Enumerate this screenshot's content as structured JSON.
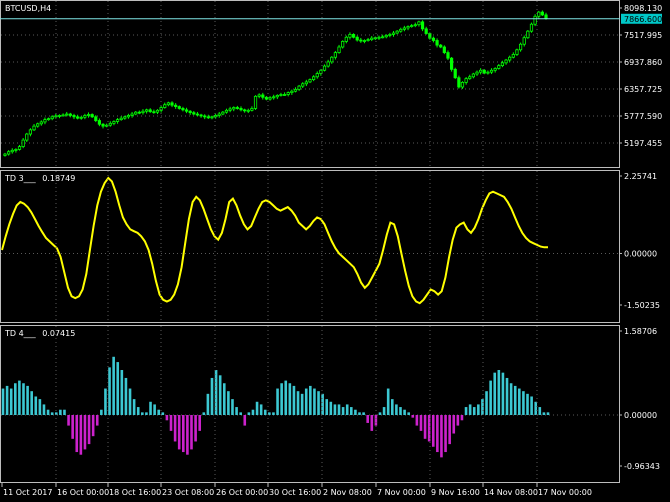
{
  "symbol_title": "BTCUSD,H4",
  "colors": {
    "background": "#000000",
    "bull_candle": "#00ff00",
    "bid_line": "#7fe6e6",
    "bid_box": "#00c8c8",
    "td3_line": "#ffff00",
    "hist_pos": "#3cc8d2",
    "hist_neg": "#cc22cc",
    "grid": "#5a5a5a",
    "separator": "#bdbdbd"
  },
  "price_panel": {
    "ticks": [
      "8098.130",
      "7517.995",
      "6937.860",
      "6357.725",
      "5777.590",
      "5197.455"
    ],
    "tick_values": [
      8098.13,
      7517.995,
      6937.86,
      6357.725,
      5777.59,
      5197.455
    ],
    "bid_label": "7866.600",
    "bid_value": 7866.6
  },
  "td3_panel": {
    "label": "TD 3___",
    "value": "0.18749",
    "ticks": [
      "2.25741",
      "0.00000",
      "-1.50235"
    ],
    "tick_values": [
      2.25741,
      0.0,
      -1.50235
    ]
  },
  "td4_panel": {
    "label": "TD 4___",
    "value": "0.07415",
    "ticks": [
      "1.58706",
      "0.00000",
      "-0.96343"
    ],
    "tick_values": [
      1.58706,
      0.0,
      -0.96343
    ]
  },
  "time_axis": [
    "11 Oct 2017",
    "16 Oct 00:00",
    "18 Oct 16:00",
    "23 Oct 08:00",
    "26 Oct 00:00",
    "30 Oct 16:00",
    "2 Nov 08:00",
    "7 Nov 00:00",
    "9 Nov 16:00",
    "14 Nov 08:00",
    "17 Nov 00:00"
  ],
  "chart_data": [
    {
      "type": "candlestick",
      "title": "BTCUSD,H4",
      "ylim": [
        5050,
        8160
      ],
      "close": [
        4960,
        5010,
        5040,
        5060,
        5120,
        5260,
        5390,
        5480,
        5560,
        5610,
        5650,
        5700,
        5720,
        5760,
        5780,
        5790,
        5800,
        5820,
        5790,
        5760,
        5730,
        5750,
        5790,
        5810,
        5760,
        5680,
        5600,
        5560,
        5580,
        5620,
        5660,
        5700,
        5730,
        5760,
        5790,
        5820,
        5860,
        5850,
        5880,
        5910,
        5870,
        5860,
        5900,
        5960,
        6020,
        6060,
        6010,
        5980,
        5940,
        5910,
        5880,
        5850,
        5820,
        5800,
        5780,
        5760,
        5740,
        5760,
        5790,
        5820,
        5860,
        5900,
        5930,
        5960,
        5940,
        5910,
        5890,
        5900,
        5940,
        6200,
        6230,
        6180,
        6140,
        6170,
        6190,
        6220,
        6240,
        6240,
        6280,
        6310,
        6350,
        6420,
        6470,
        6510,
        6560,
        6620,
        6690,
        6760,
        6850,
        6940,
        7040,
        7140,
        7260,
        7380,
        7470,
        7530,
        7470,
        7410,
        7390,
        7400,
        7420,
        7450,
        7460,
        7470,
        7480,
        7510,
        7530,
        7560,
        7600,
        7640,
        7670,
        7700,
        7720,
        7740,
        7800,
        7650,
        7550,
        7450,
        7400,
        7300,
        7260,
        7140,
        7020,
        6780,
        6600,
        6400,
        6500,
        6580,
        6620,
        6680,
        6720,
        6760,
        6700,
        6720,
        6760,
        6800,
        6860,
        6920,
        6980,
        7040,
        7100,
        7200,
        7320,
        7460,
        7600,
        7750,
        7920,
        8010,
        7950,
        7880
      ],
      "series_note": ""
    },
    {
      "type": "line",
      "title": "TD 3___",
      "y": [
        0.1,
        0.5,
        0.85,
        1.15,
        1.4,
        1.5,
        1.45,
        1.35,
        1.2,
        1.0,
        0.8,
        0.62,
        0.45,
        0.35,
        0.25,
        0.15,
        -0.1,
        -0.55,
        -1.0,
        -1.25,
        -1.3,
        -1.25,
        -1.05,
        -0.6,
        0.1,
        0.8,
        1.4,
        1.8,
        2.05,
        2.2,
        2.1,
        1.8,
        1.4,
        1.05,
        0.85,
        0.7,
        0.65,
        0.6,
        0.5,
        0.35,
        0.1,
        -0.3,
        -0.8,
        -1.2,
        -1.35,
        -1.4,
        -1.35,
        -1.2,
        -0.9,
        -0.4,
        0.3,
        1.0,
        1.5,
        1.65,
        1.55,
        1.3,
        1.0,
        0.7,
        0.5,
        0.4,
        0.6,
        1.0,
        1.5,
        1.6,
        1.4,
        1.1,
        0.85,
        0.7,
        0.8,
        1.05,
        1.3,
        1.5,
        1.55,
        1.5,
        1.4,
        1.3,
        1.25,
        1.3,
        1.35,
        1.25,
        1.1,
        0.9,
        0.8,
        0.7,
        0.8,
        0.95,
        1.05,
        1.0,
        0.85,
        0.6,
        0.35,
        0.15,
        0.0,
        -0.1,
        -0.2,
        -0.3,
        -0.4,
        -0.6,
        -0.85,
        -1.0,
        -0.9,
        -0.7,
        -0.5,
        -0.3,
        0.1,
        0.55,
        0.9,
        0.85,
        0.5,
        0.0,
        -0.5,
        -0.95,
        -1.25,
        -1.4,
        -1.45,
        -1.35,
        -1.2,
        -1.05,
        -1.1,
        -1.2,
        -1.1,
        -0.7,
        -0.1,
        0.4,
        0.75,
        0.85,
        0.9,
        0.7,
        0.6,
        0.75,
        1.0,
        1.3,
        1.55,
        1.75,
        1.8,
        1.75,
        1.7,
        1.65,
        1.5,
        1.3,
        1.05,
        0.8,
        0.6,
        0.45,
        0.35,
        0.3,
        0.25,
        0.2,
        0.18,
        0.18
      ]
    },
    {
      "type": "bar",
      "title": "TD 4___",
      "values": [
        0.5,
        0.55,
        0.5,
        0.6,
        0.65,
        0.6,
        0.55,
        0.45,
        0.35,
        0.3,
        0.2,
        0.1,
        0.05,
        0.05,
        0.1,
        0.1,
        -0.2,
        -0.45,
        -0.7,
        -0.75,
        -0.65,
        -0.55,
        -0.4,
        -0.2,
        0.1,
        0.5,
        0.9,
        1.1,
        1.0,
        0.85,
        0.7,
        0.5,
        0.3,
        0.15,
        0.05,
        0.05,
        0.25,
        0.2,
        0.1,
        0.05,
        -0.1,
        -0.3,
        -0.5,
        -0.65,
        -0.7,
        -0.75,
        -0.65,
        -0.5,
        -0.3,
        0.05,
        0.4,
        0.7,
        0.85,
        0.75,
        0.6,
        0.45,
        0.3,
        0.15,
        0.05,
        -0.2,
        0.05,
        0.1,
        0.25,
        0.2,
        0.1,
        0.05,
        0.05,
        0.5,
        0.6,
        0.65,
        0.6,
        0.55,
        0.45,
        0.4,
        0.5,
        0.55,
        0.5,
        0.45,
        0.4,
        0.3,
        0.25,
        0.2,
        0.2,
        0.15,
        0.2,
        0.15,
        0.1,
        0.05,
        0.05,
        -0.15,
        -0.3,
        -0.2,
        0.05,
        0.15,
        0.5,
        0.3,
        0.2,
        0.15,
        0.1,
        0.05,
        -0.05,
        -0.2,
        -0.3,
        -0.45,
        -0.5,
        -0.6,
        -0.7,
        -0.8,
        -0.7,
        -0.55,
        -0.35,
        -0.2,
        -0.1,
        0.15,
        0.2,
        0.15,
        0.2,
        0.3,
        0.45,
        0.65,
        0.8,
        0.85,
        0.8,
        0.7,
        0.6,
        0.55,
        0.5,
        0.45,
        0.4,
        0.35,
        0.25,
        0.15,
        0.05,
        0.05
      ]
    }
  ]
}
